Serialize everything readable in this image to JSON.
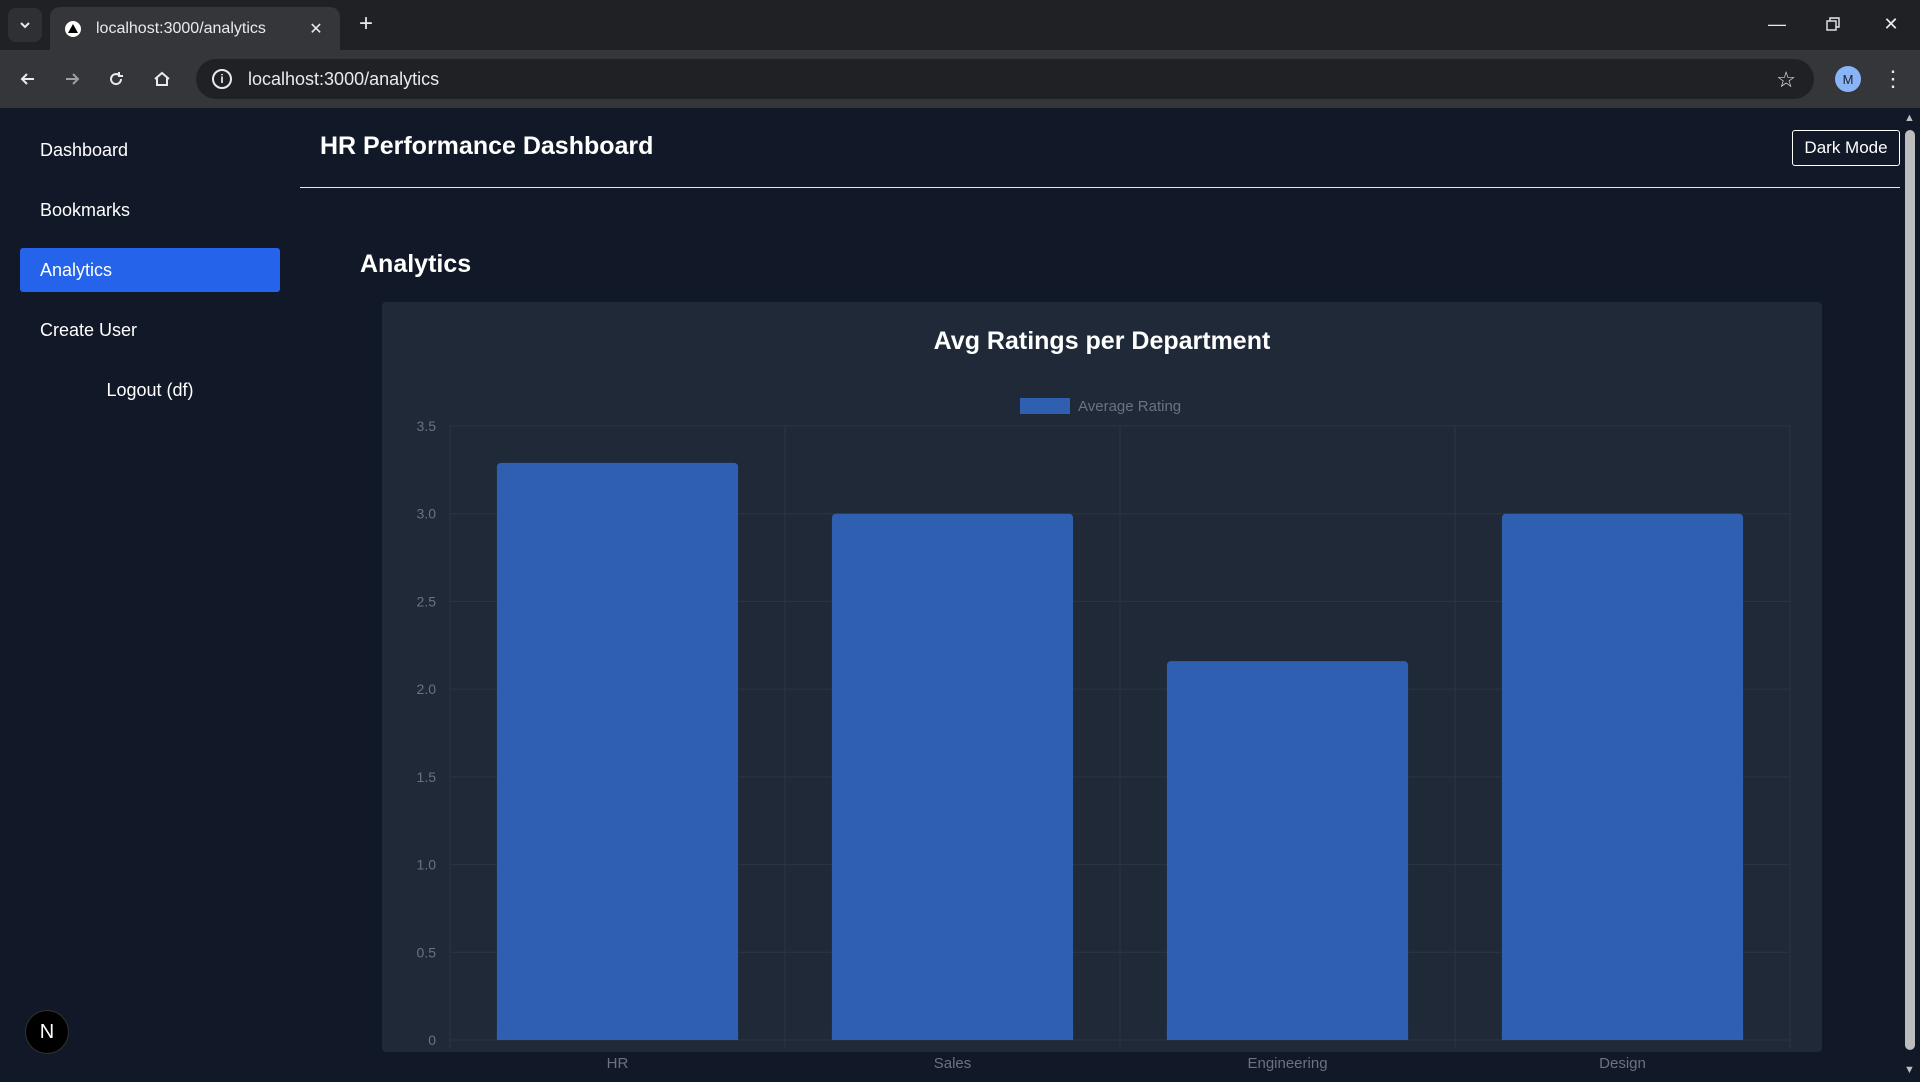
{
  "browser": {
    "tab_title": "localhost:3000/analytics",
    "url": "localhost:3000/analytics",
    "profile_initial": "M"
  },
  "sidebar": {
    "items": [
      {
        "label": "Dashboard"
      },
      {
        "label": "Bookmarks"
      },
      {
        "label": "Analytics"
      },
      {
        "label": "Create User"
      }
    ],
    "logout_label": "Logout (df)",
    "badge": "N"
  },
  "header": {
    "title": "HR Performance Dashboard",
    "dark_mode_label": "Dark Mode"
  },
  "main": {
    "section_title": "Analytics"
  },
  "colors": {
    "accent": "#2563eb",
    "bar": "#2f5fb0",
    "background": "#111827",
    "card": "#1f2937"
  },
  "chart_data": {
    "type": "bar",
    "title": "Avg Ratings per Department",
    "categories": [
      "HR",
      "Sales",
      "Engineering",
      "Design"
    ],
    "series": [
      {
        "name": "Average Rating",
        "values": [
          3.29,
          3.0,
          2.16,
          3.0
        ]
      }
    ],
    "ylim": [
      0,
      3.5
    ],
    "yticks": [
      "0",
      "0.5",
      "1.0",
      "1.5",
      "2.0",
      "2.5",
      "3.0",
      "3.5"
    ],
    "xlabel": "",
    "ylabel": "",
    "grid": true,
    "legend": "top-center"
  }
}
